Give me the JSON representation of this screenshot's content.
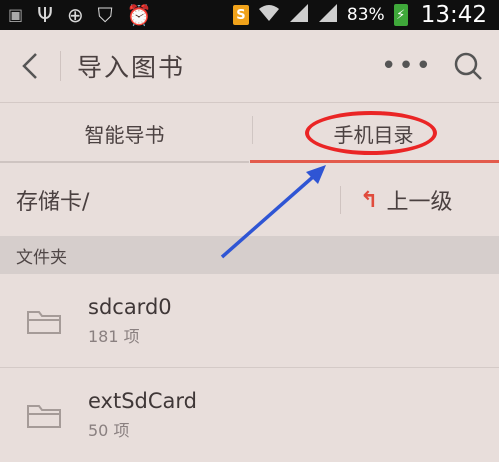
{
  "status_bar": {
    "battery_percent": "83%",
    "time": "13:42",
    "sim_label": "S",
    "icons": [
      "app-icon",
      "usb-icon",
      "location-icon",
      "shield-icon",
      "alarm-icon",
      "sim-icon",
      "wifi-icon",
      "signal-icon",
      "signal-icon",
      "battery-charging-icon"
    ]
  },
  "header": {
    "title": "导入图书",
    "more_label": "•••"
  },
  "tabs": [
    {
      "label": "智能导书",
      "selected": false
    },
    {
      "label": "手机目录",
      "selected": true
    }
  ],
  "path": {
    "current": "存储卡/",
    "up_label": "上一级",
    "up_arrow": "↰"
  },
  "section": {
    "label": "文件夹"
  },
  "folders": [
    {
      "name": "sdcard0",
      "count": "181 项"
    },
    {
      "name": "extSdCard",
      "count": "50 项"
    }
  ],
  "colors": {
    "accent_red": "#e35b4c",
    "annotation_red": "#ea2525",
    "annotation_blue": "#2f55d4",
    "background": "#e8dedb"
  }
}
